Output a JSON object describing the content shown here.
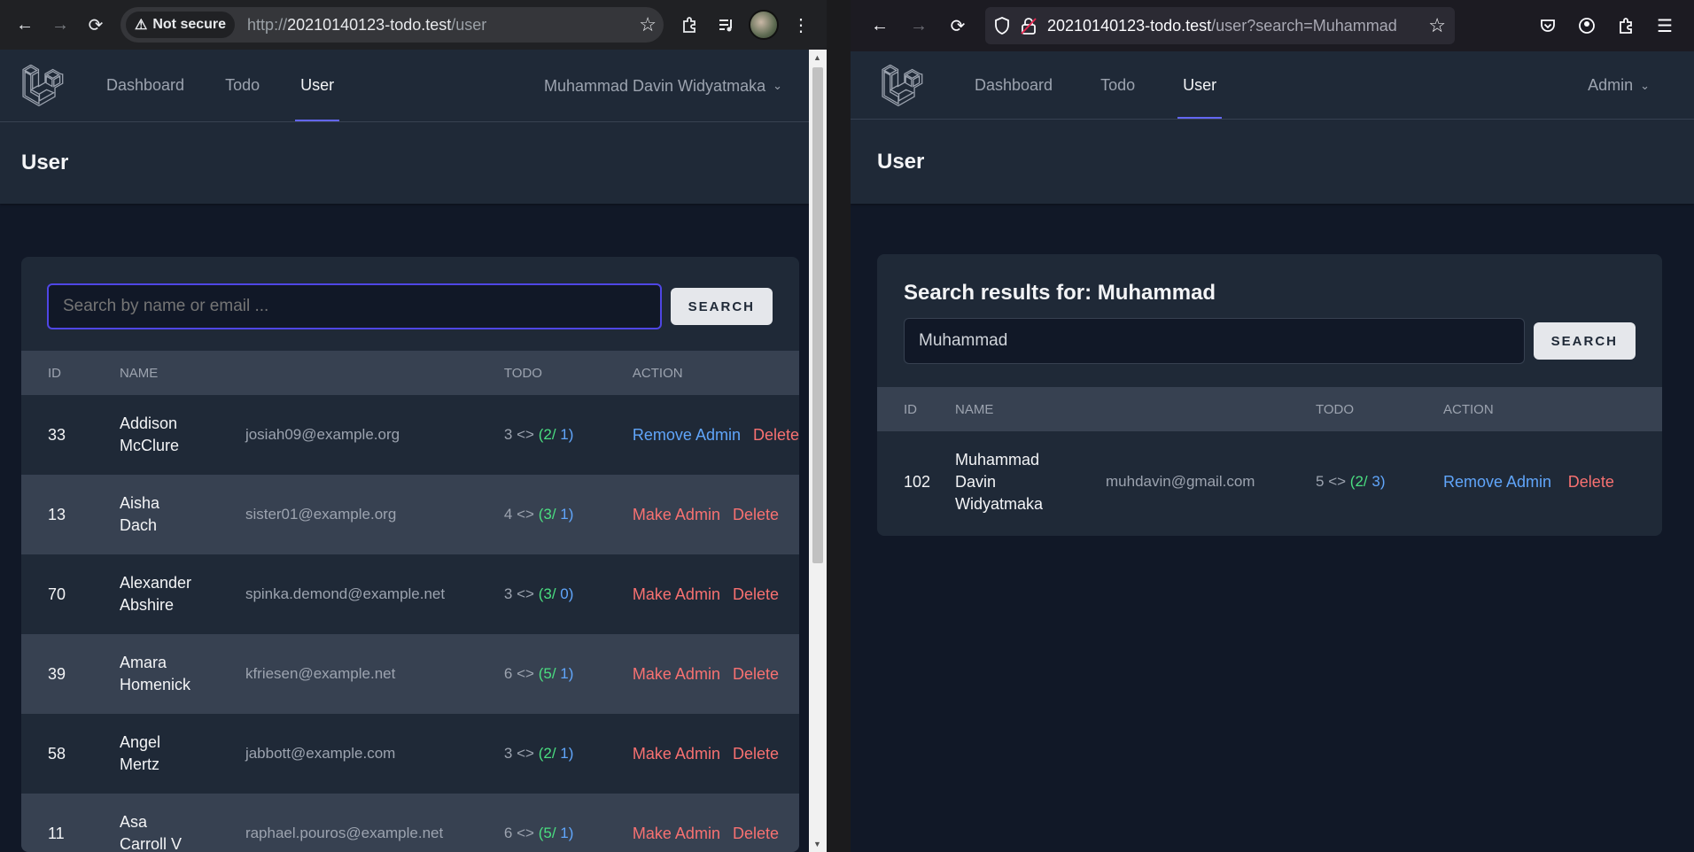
{
  "left_browser": {
    "security_label": "Not secure",
    "url_prefix": "http://",
    "url_host": "20210140123-todo.test",
    "url_path": "/user"
  },
  "right_browser": {
    "url_host": "20210140123-todo.test",
    "url_rest": "/user?search=Muhammad"
  },
  "nav": {
    "dashboard": "Dashboard",
    "todo": "Todo",
    "user": "User"
  },
  "left_app": {
    "user_name": "Muhammad Davin Widyatmaka",
    "page_title": "User",
    "search_placeholder": "Search by name or email ...",
    "search_button": "SEARCH",
    "columns": {
      "id": "ID",
      "name": "NAME",
      "todo": "TODO",
      "action": "ACTION"
    },
    "rows": [
      {
        "id": "33",
        "first": "Addison",
        "last": "McClure",
        "email": "josiah09@example.org",
        "todo_total": "3",
        "todo_done": "2",
        "todo_open": "1",
        "action": "Remove Admin",
        "delete": "Delete"
      },
      {
        "id": "13",
        "first": "Aisha",
        "last": "Dach",
        "email": "sister01@example.org",
        "todo_total": "4",
        "todo_done": "3",
        "todo_open": "1",
        "action": "Make Admin",
        "delete": "Delete"
      },
      {
        "id": "70",
        "first": "Alexander",
        "last": "Abshire",
        "email": "spinka.demond@example.net",
        "todo_total": "3",
        "todo_done": "3",
        "todo_open": "0",
        "action": "Make Admin",
        "delete": "Delete"
      },
      {
        "id": "39",
        "first": "Amara",
        "last": "Homenick",
        "email": "kfriesen@example.net",
        "todo_total": "6",
        "todo_done": "5",
        "todo_open": "1",
        "action": "Make Admin",
        "delete": "Delete"
      },
      {
        "id": "58",
        "first": "Angel",
        "last": "Mertz",
        "email": "jabbott@example.com",
        "todo_total": "3",
        "todo_done": "2",
        "todo_open": "1",
        "action": "Make Admin",
        "delete": "Delete"
      },
      {
        "id": "11",
        "first": "Asa",
        "last": "Carroll V",
        "email": "raphael.pouros@example.net",
        "todo_total": "6",
        "todo_done": "5",
        "todo_open": "1",
        "action": "Make Admin",
        "delete": "Delete"
      }
    ]
  },
  "right_app": {
    "user_name": "Admin",
    "page_title": "User",
    "results_title": "Search results for: Muhammad",
    "search_value": "Muhammad",
    "search_button": "SEARCH",
    "columns": {
      "id": "ID",
      "name": "NAME",
      "todo": "TODO",
      "action": "ACTION"
    },
    "row": {
      "id": "102",
      "name1": "Muhammad",
      "name2": "Davin",
      "name3": "Widyatmaka",
      "email": "muhdavin@gmail.com",
      "todo_total": "5",
      "todo_done": "2",
      "todo_open": "3",
      "action": "Remove Admin",
      "delete": "Delete"
    }
  }
}
